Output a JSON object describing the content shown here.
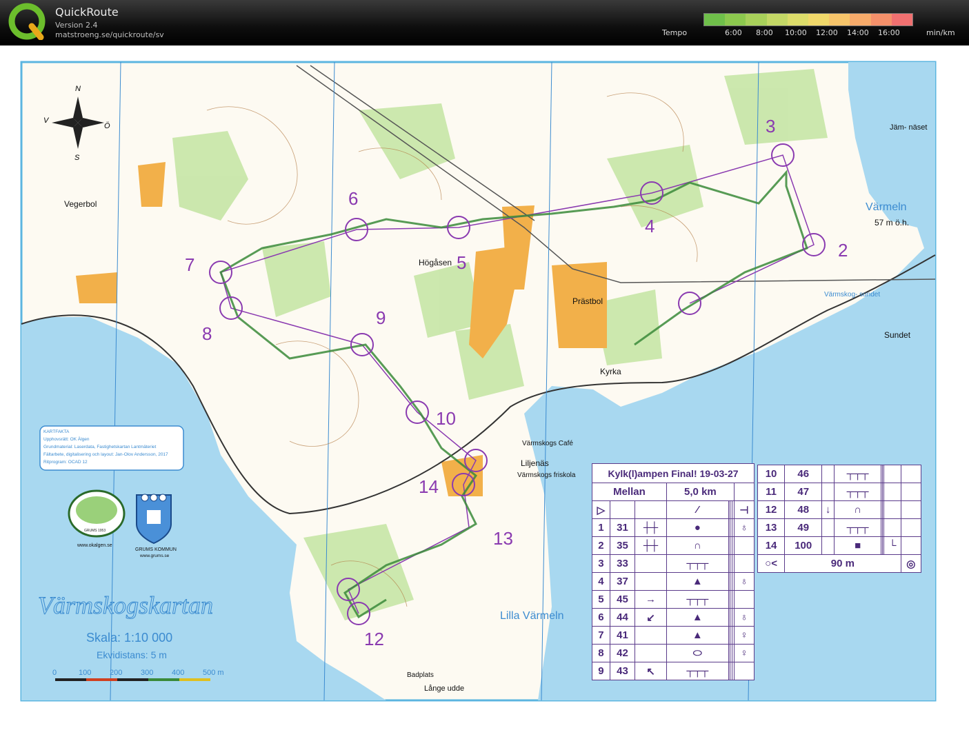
{
  "header": {
    "app_title": "QuickRoute",
    "version": "Version 2.4",
    "url": "matstroeng.se/quickroute/sv",
    "tempo_label": "Tempo",
    "tempo_ticks": [
      "6:00",
      "8:00",
      "10:00",
      "12:00",
      "14:00",
      "16:00"
    ],
    "tempo_unit": "min/km",
    "tempo_colors": [
      "#6fbf4a",
      "#8cc84e",
      "#a8d05a",
      "#c4d866",
      "#dcdc6a",
      "#f0d86a",
      "#f6c46a",
      "#f6aa6a",
      "#f4906a",
      "#f07070"
    ]
  },
  "map": {
    "compass": {
      "n": "N",
      "s": "S",
      "e": "Ö",
      "w": "V"
    },
    "place_names": {
      "vegerbol": "Vegerbol",
      "hogasen": "Högåsen",
      "prastbol": "Prästbol",
      "kyrka": "Kyrka",
      "jamnaset": "Jäm-\nnäset",
      "varmeln": "Värmeln",
      "varmeln_height": "57 m ö.h.",
      "varmskogsundet": "Värmskog-\nsundet",
      "sundet": "Sundet",
      "cafe": "Värmskogs\nCafé",
      "liljenas": "Liljenäs",
      "friskola": "Värmskogs\nfriskola",
      "lilla_varmeln": "Lilla Värmeln",
      "badplats": "Badplats",
      "lange_udde": "Långe udde"
    },
    "map_title": "Värmskogskartan",
    "scale": "Skala: 1:10 000",
    "contour": "Ekvidistans: 5 m",
    "scalebar_ticks": [
      "0",
      "100",
      "200",
      "300",
      "400",
      "500 m"
    ],
    "kartfakta": {
      "heading": "KARTFAKTA",
      "lines": [
        "Upphovsrätt: OK Älgen",
        "Grundmaterial: Laserdata, Fastighetskartan Lantmäteriet",
        "Fältarbete, digitalisering och layout: Jan-Olov Andersson, 2017",
        "Ritprogram: OCAD 12"
      ]
    },
    "logos": {
      "club_url": "www.okalgen.se",
      "club_badge": "GRUMS 1953",
      "kommun": "GRUMS KOMMUN",
      "kommun_url": "www.grums.se"
    },
    "control_numbers": [
      "2",
      "3",
      "4",
      "5",
      "6",
      "7",
      "8",
      "9",
      "10",
      "12",
      "13",
      "14"
    ],
    "route_color": "#3a8a3a",
    "course_color": "#8a3ab0",
    "water_color": "#a8d8f0",
    "open_color": "#f2b04a"
  },
  "description": {
    "title": "Kylk(l)ampen Final! 19-03-27",
    "class": "Mellan",
    "length": "5,0 km",
    "rows_left": [
      {
        "n": "1",
        "code": "31"
      },
      {
        "n": "2",
        "code": "35"
      },
      {
        "n": "3",
        "code": "33"
      },
      {
        "n": "4",
        "code": "37"
      },
      {
        "n": "5",
        "code": "45"
      },
      {
        "n": "6",
        "code": "44"
      },
      {
        "n": "7",
        "code": "41"
      },
      {
        "n": "8",
        "code": "42"
      },
      {
        "n": "9",
        "code": "43"
      }
    ],
    "rows_right": [
      {
        "n": "10",
        "code": "46"
      },
      {
        "n": "11",
        "code": "47"
      },
      {
        "n": "12",
        "code": "48"
      },
      {
        "n": "13",
        "code": "49"
      },
      {
        "n": "14",
        "code": "100"
      }
    ],
    "finish_distance": "90 m"
  }
}
